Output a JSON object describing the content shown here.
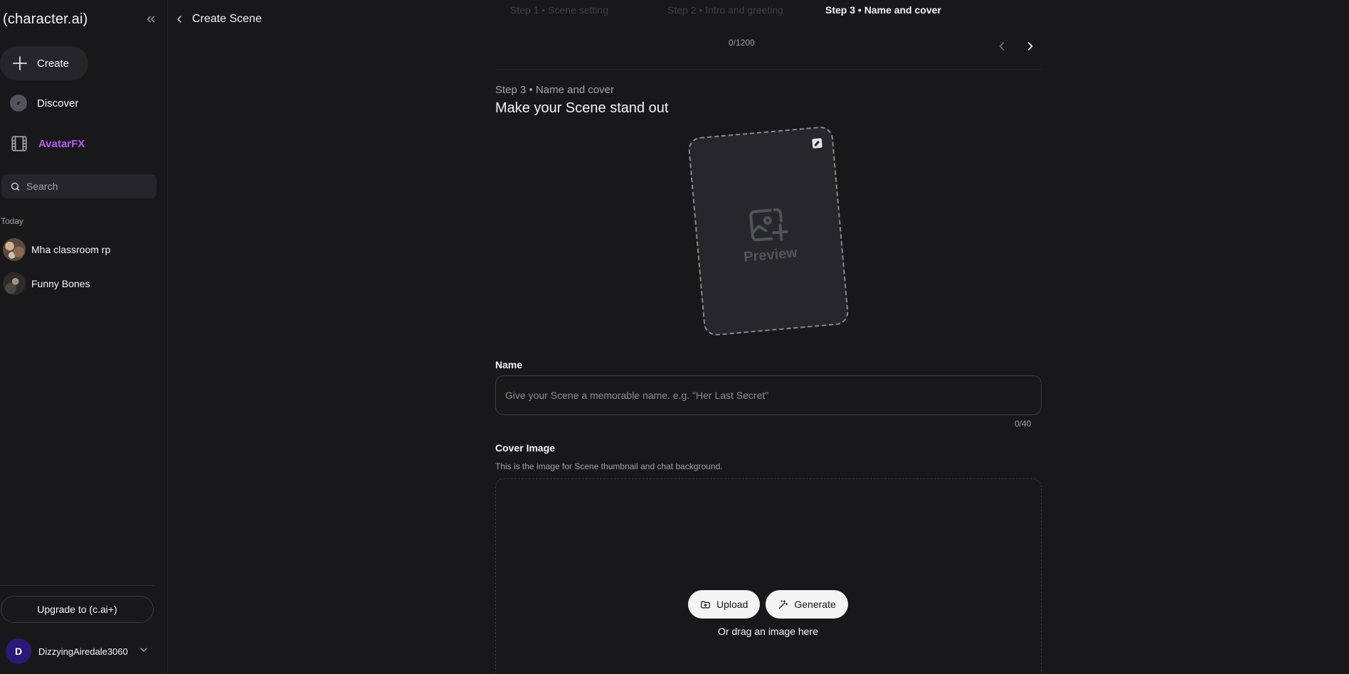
{
  "sidebar": {
    "logo": "(character.ai)",
    "create_label": "Create",
    "discover_label": "Discover",
    "avatarfx_label": "AvatarFX",
    "search_placeholder": "Search",
    "section_today": "Today",
    "chats": [
      {
        "name": "Mha classroom rp"
      },
      {
        "name": "Funny Bones"
      }
    ],
    "upgrade_label": "Upgrade to (c.ai+)",
    "user": {
      "initial": "D",
      "name": "DizzyingAiredale3060"
    }
  },
  "header": {
    "back_title": "Create Scene"
  },
  "steps": {
    "items": [
      {
        "label": "Step 1 • Scene setting"
      },
      {
        "label": "Step 2 • Intro and greeting"
      },
      {
        "label": "Step 3 • Name and cover"
      }
    ],
    "counter": "0/1200"
  },
  "main": {
    "step_label": "Step 3 • Name and cover",
    "heading": "Make your Scene stand out",
    "preview_text": "Preview",
    "name_label": "Name",
    "name_placeholder": "Give your Scene a memorable name. e.g. \"Her Last Secret\"",
    "name_value": "",
    "name_count": "0/40",
    "cover_label": "Cover Image",
    "cover_desc": "This is the image for Scene thumbnail and chat background.",
    "upload_label": "Upload",
    "generate_label": "Generate",
    "drag_text": "Or drag an image here"
  },
  "colors": {
    "background": "#18181b",
    "accent_avatarfx": "#b65cf0",
    "user_avatar": "#2c1878"
  }
}
